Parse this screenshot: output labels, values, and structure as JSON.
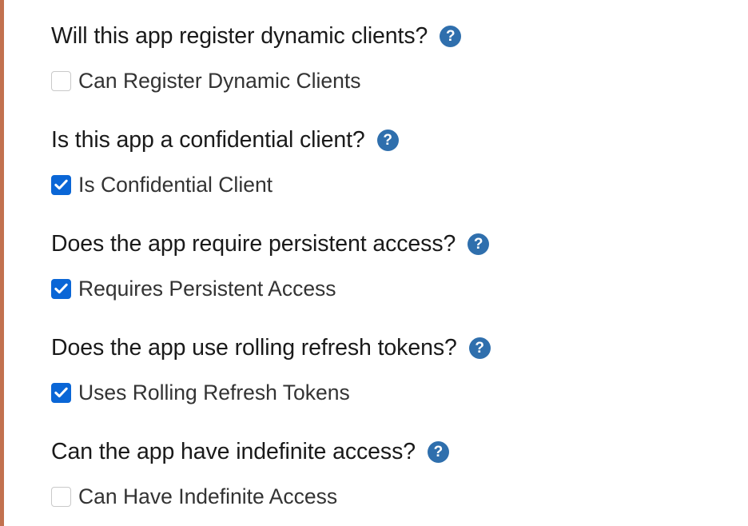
{
  "colors": {
    "accent_bar": "#c2714f",
    "help_icon": "#2f6fad",
    "checkbox_checked": "#0a66d6"
  },
  "help_icon_glyph": "?",
  "sections": [
    {
      "question": "Will this app register dynamic clients?",
      "help_icon": "question-circle-icon",
      "option_label": "Can Register Dynamic Clients",
      "checked": false
    },
    {
      "question": "Is this app a confidential client?",
      "help_icon": "question-circle-icon",
      "option_label": "Is Confidential Client",
      "checked": true
    },
    {
      "question": "Does the app require persistent access?",
      "help_icon": "question-circle-icon",
      "option_label": "Requires Persistent Access",
      "checked": true
    },
    {
      "question": "Does the app use rolling refresh tokens?",
      "help_icon": "question-circle-icon",
      "option_label": "Uses Rolling Refresh Tokens",
      "checked": true
    },
    {
      "question": "Can the app have indefinite access?",
      "help_icon": "question-circle-icon",
      "option_label": "Can Have Indefinite Access",
      "checked": false
    }
  ]
}
